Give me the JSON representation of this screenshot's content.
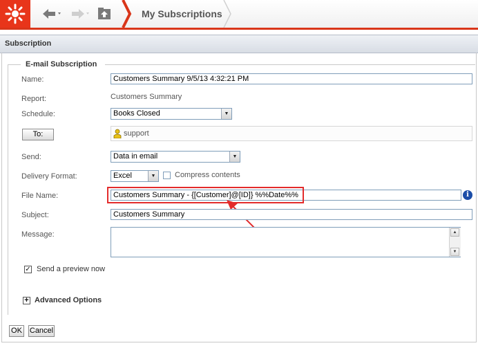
{
  "toolbar": {
    "breadcrumb": "My Subscriptions",
    "accent_color": "#d9361a",
    "icons": [
      "logo-burst-icon",
      "back-arrow-icon",
      "forward-arrow-icon",
      "up-folder-icon"
    ]
  },
  "section": {
    "title": "Subscription"
  },
  "form": {
    "legend": "E-mail Subscription",
    "name_label": "Name:",
    "name_value": "Customers Summary 9/5/13 4:32:21 PM",
    "report_label": "Report:",
    "report_value": "Customers Summary",
    "schedule_label": "Schedule:",
    "schedule_value": "Books Closed",
    "to_button": "To:",
    "recipient": "support",
    "send_label": "Send:",
    "send_value": "Data in email",
    "format_label": "Delivery Format:",
    "format_value": "Excel",
    "compress_label": "Compress contents",
    "file_label": "File Name:",
    "file_value": "Customers Summary - {[Customer]@[ID]} %%Date%%",
    "subject_label": "Subject:",
    "subject_value": "Customers Summary",
    "message_label": "Message:",
    "preview_label": "Send a preview now",
    "preview_checked": true,
    "advanced_label": "Advanced Options",
    "info_glyph": "i",
    "highlight_color": "#e32b2b"
  },
  "actions": {
    "ok": "OK",
    "cancel": "Cancel"
  }
}
